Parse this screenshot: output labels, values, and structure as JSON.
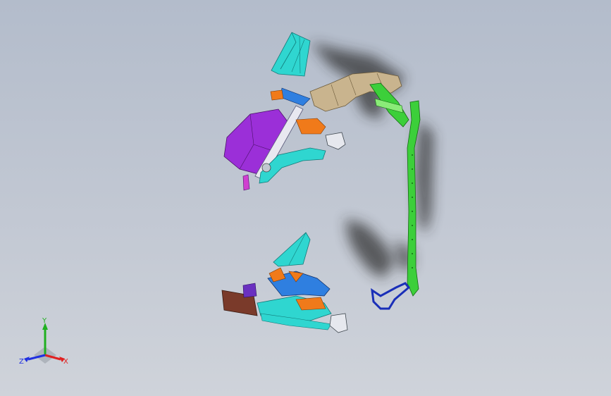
{
  "viewport": {
    "background_top": "#b3bccb",
    "background_bottom": "#cfd3da"
  },
  "model": {
    "part_colors": {
      "cyan": "#2fd6d0",
      "magenta": "#9b2fd8",
      "orange": "#f07a1a",
      "tan": "#c9b48e",
      "green": "#3ccf3a",
      "navy": "#1a2fb8",
      "blue": "#2f7fe0",
      "brown": "#7a3a2a",
      "shadow": "#2a2a2a"
    }
  },
  "triad": {
    "y_label": "Y",
    "x_label": "X",
    "z_label": "Z",
    "x_color": "#e02020",
    "y_color": "#20b020",
    "z_color": "#2030e0"
  }
}
